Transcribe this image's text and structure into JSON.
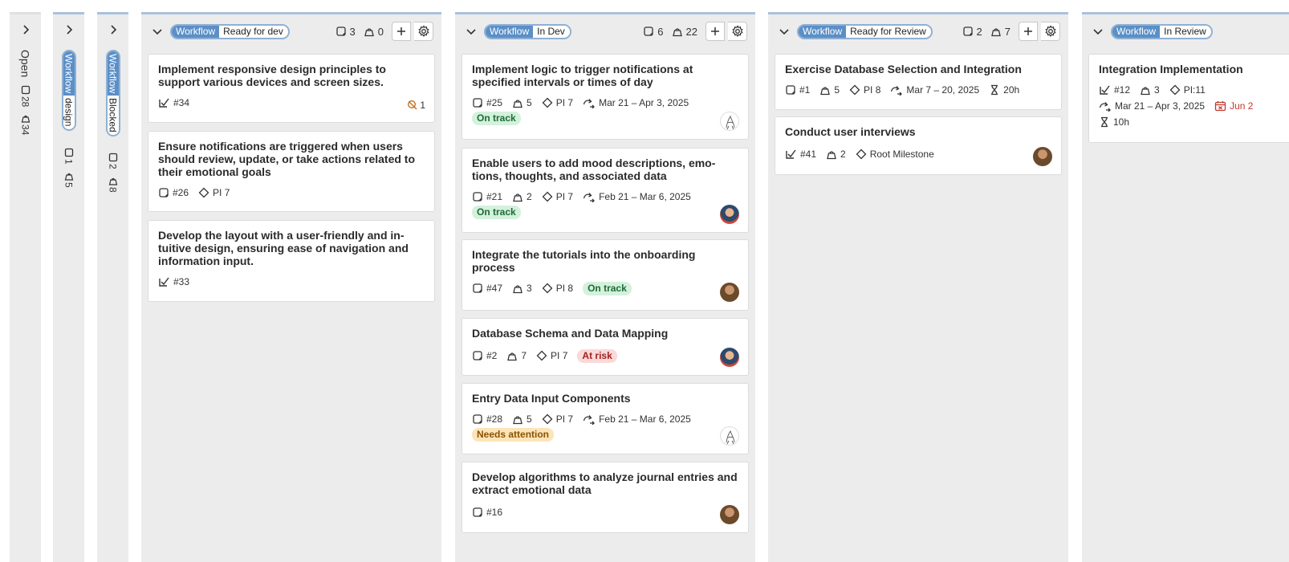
{
  "collapsed_columns": [
    {
      "label": "Open",
      "issues": "28",
      "points": "34"
    },
    {
      "badge_key": "Workflow",
      "badge_value": "design",
      "issues": "1",
      "points": "5"
    },
    {
      "badge_key": "Workflow",
      "badge_value": "Blocked",
      "issues": "2",
      "points": "8"
    }
  ],
  "columns": [
    {
      "badge_key": "Workflow",
      "badge_value": "Ready for dev",
      "issues": "3",
      "points": "0",
      "cards": [
        {
          "title": "Implement responsive design principles to support various devices and screen sizes.",
          "id": "#34",
          "warning_count": "1"
        },
        {
          "title": "Ensure notifications are triggered when users should review, update, or take actions related to their emotional goals",
          "id": "#26",
          "milestone": "PI 7"
        },
        {
          "title": "Develop the layout with a user-friendly and in-tuitive design, ensuring ease of navigation and information input.",
          "id": "#33"
        }
      ]
    },
    {
      "badge_key": "Workflow",
      "badge_value": "In Dev",
      "issues": "6",
      "points": "22",
      "cards": [
        {
          "title": "Implement logic to trigger notifications at specified intervals or times of day",
          "id": "#25",
          "points": "5",
          "milestone": "PI 7",
          "dates": "Mar 21 – Apr 3, 2025",
          "status": "On track"
        },
        {
          "title": "Enable users to add mood descriptions, emo-tions, thoughts, and associated data",
          "id": "#21",
          "points": "2",
          "milestone": "PI 7",
          "dates": "Feb 21 – Mar 6, 2025",
          "status": "On track"
        },
        {
          "title": "Integrate the tutorials into the onboarding process",
          "id": "#47",
          "points": "3",
          "milestone": "PI 8",
          "status": "On track"
        },
        {
          "title": "Database Schema and Data Mapping",
          "id": "#2",
          "points": "7",
          "milestone": "PI 7",
          "status": "At risk"
        },
        {
          "title": "Entry Data Input Components",
          "id": "#28",
          "points": "5",
          "milestone": "PI 7",
          "dates": "Feb 21 – Mar 6, 2025",
          "status": "Needs attention"
        },
        {
          "title": "Develop algorithms to analyze journal entries and extract emotional data",
          "id": "#16"
        }
      ]
    },
    {
      "badge_key": "Workflow",
      "badge_value": "Ready for Review",
      "issues": "2",
      "points": "7",
      "cards": [
        {
          "title": "Exercise Database Selection and Integration",
          "id": "#1",
          "points": "5",
          "milestone": "PI 8",
          "dates": "Mar 7 – 20, 2025",
          "estimate": "20h"
        },
        {
          "title": "Conduct user interviews",
          "id": "#41",
          "points": "2",
          "milestone": "Root Milestone"
        }
      ]
    },
    {
      "badge_key": "Workflow",
      "badge_value": "In Review",
      "cards": [
        {
          "title": "Integration Implementation",
          "id": "#12",
          "points": "3",
          "milestone": "PI:11",
          "dates": "Mar 21 – Apr 3, 2025",
          "due": "Jun 2",
          "estimate": "10h"
        }
      ]
    }
  ]
}
